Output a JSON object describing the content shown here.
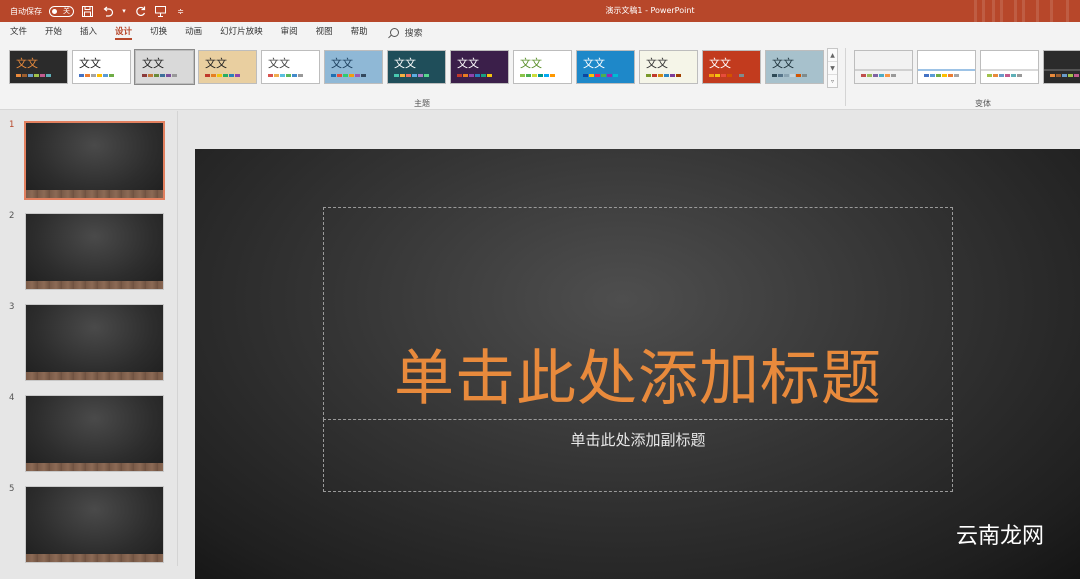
{
  "titlebar": {
    "autosave_label": "自动保存",
    "autosave_state": "关",
    "title": "演示文稿1  -  PowerPoint"
  },
  "tabs": [
    {
      "label": "文件",
      "active": false
    },
    {
      "label": "开始",
      "active": false
    },
    {
      "label": "插入",
      "active": false
    },
    {
      "label": "设计",
      "active": true
    },
    {
      "label": "切换",
      "active": false
    },
    {
      "label": "动画",
      "active": false
    },
    {
      "label": "幻灯片放映",
      "active": false
    },
    {
      "label": "审阅",
      "active": false
    },
    {
      "label": "视图",
      "active": false
    },
    {
      "label": "帮助",
      "active": false
    }
  ],
  "search_label": "搜索",
  "ribbon": {
    "themes_group_label": "主题",
    "variants_group_label": "变体",
    "theme_sample_text": "文文",
    "themes": [
      {
        "bg": "#2b2b2b",
        "text_color": "#e88a3c",
        "swatches": [
          "#e88a3c",
          "#9c5e2f",
          "#6a9bc8",
          "#a0c24b",
          "#c25b8e",
          "#5fb0b7"
        ]
      },
      {
        "bg": "#ffffff",
        "text_color": "#222222",
        "swatches": [
          "#4472c4",
          "#ed7d31",
          "#a5a5a5",
          "#ffc000",
          "#5b9bd5",
          "#70ad47"
        ]
      },
      {
        "bg": "#d9d9d9",
        "text_color": "#222222",
        "swatches": [
          "#8c3b3b",
          "#c57a39",
          "#6a8a3a",
          "#3c6f9b",
          "#7a4f9b",
          "#999999"
        ]
      },
      {
        "bg": "#e9cfa0",
        "text_color": "#222222",
        "swatches": [
          "#c0392b",
          "#e67e22",
          "#f1c40f",
          "#27ae60",
          "#2980b9",
          "#8e44ad"
        ]
      },
      {
        "bg": "#ffffff",
        "text_color": "#444444",
        "swatches": [
          "#d9534f",
          "#f0ad4e",
          "#5bc0de",
          "#5cb85c",
          "#428bca",
          "#999999"
        ]
      },
      {
        "bg": "#8fb8d6",
        "text_color": "#1a3d5c",
        "swatches": [
          "#1f6fb2",
          "#e84c3d",
          "#2ecc71",
          "#f39c12",
          "#9b59b6",
          "#34495e"
        ]
      },
      {
        "bg": "#1f4e5a",
        "text_color": "#ffffff",
        "swatches": [
          "#48c9b0",
          "#f5b041",
          "#ec7063",
          "#5dade2",
          "#af7ac5",
          "#58d68d"
        ]
      },
      {
        "bg": "#3b1f4a",
        "text_color": "#ffffff",
        "swatches": [
          "#c0392b",
          "#e67e22",
          "#8e44ad",
          "#2980b9",
          "#16a085",
          "#f1c40f"
        ]
      },
      {
        "bg": "#ffffff",
        "text_color": "#5a8f2a",
        "swatches": [
          "#8bc34a",
          "#4caf50",
          "#cddc39",
          "#009688",
          "#03a9f4",
          "#ff9800"
        ]
      },
      {
        "bg": "#1e88c9",
        "text_color": "#ffffff",
        "swatches": [
          "#0d47a1",
          "#ffc107",
          "#e91e63",
          "#4caf50",
          "#9c27b0",
          "#00bcd4"
        ]
      },
      {
        "bg": "#f5f5e8",
        "text_color": "#333333",
        "swatches": [
          "#7a9a2a",
          "#c0392b",
          "#d68910",
          "#2e86c1",
          "#7d3c98",
          "#a04000"
        ]
      },
      {
        "bg": "#c23b1e",
        "text_color": "#ffffff",
        "swatches": [
          "#f39c12",
          "#f1c40f",
          "#e74c3c",
          "#d35400",
          "#c0392b",
          "#7f8c8d"
        ]
      },
      {
        "bg": "#a7c1cc",
        "text_color": "#1b2f38",
        "swatches": [
          "#2e4a56",
          "#56758a",
          "#8aa4b2",
          "#c6d3da",
          "#d35400",
          "#7f8c8d"
        ]
      }
    ],
    "variants": [
      {
        "bg": "#f2f2f2",
        "bar": "#d0d0d0",
        "swatches": [
          "#c0504d",
          "#9bbb59",
          "#8064a2",
          "#4bacc6",
          "#f79646",
          "#999999"
        ]
      },
      {
        "bg": "#ffffff",
        "bar": "#9dc3e6",
        "swatches": [
          "#4472c4",
          "#5b9bd5",
          "#70ad47",
          "#ffc000",
          "#ed7d31",
          "#a5a5a5"
        ]
      },
      {
        "bg": "#ffffff",
        "bar": "#d9d9d9",
        "swatches": [
          "#a0c24b",
          "#e88a3c",
          "#6a9bc8",
          "#c25b8e",
          "#5fb0b7",
          "#999999"
        ]
      },
      {
        "bg": "#2b2b2b",
        "bar": "#555555",
        "swatches": [
          "#e88a3c",
          "#9c5e2f",
          "#6a9bc8",
          "#a0c24b",
          "#c25b8e",
          "#5fb0b7"
        ]
      }
    ]
  },
  "thumbnails": [
    {
      "number": "1",
      "selected": true
    },
    {
      "number": "2",
      "selected": false
    },
    {
      "number": "3",
      "selected": false
    },
    {
      "number": "4",
      "selected": false
    },
    {
      "number": "5",
      "selected": false
    }
  ],
  "slide": {
    "title_placeholder": "单击此处添加标题",
    "subtitle_placeholder": "单击此处添加副标题"
  },
  "watermark": "云南龙网",
  "colors": {
    "accent": "#b7472a",
    "title_text": "#e88a3c",
    "selected_thumb_border": "#e2805f"
  }
}
